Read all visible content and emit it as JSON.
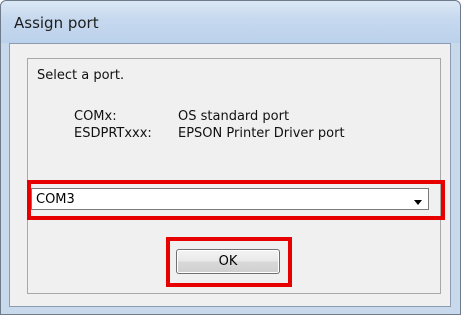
{
  "window": {
    "title": "Assign port"
  },
  "dialog": {
    "instruction": "Select a port.",
    "ports": [
      {
        "code": "COMx:",
        "description": "OS standard port"
      },
      {
        "code": "ESDPRTxxx:",
        "description": "EPSON Printer Driver port"
      }
    ],
    "port_select": {
      "value": "COM3"
    },
    "ok_label": "OK"
  },
  "colors": {
    "highlight": "#e60000",
    "titlebar": "#c5d8ee",
    "client_background": "#f0f0f0"
  },
  "icons": {
    "dropdown": "triangle-down-icon"
  }
}
